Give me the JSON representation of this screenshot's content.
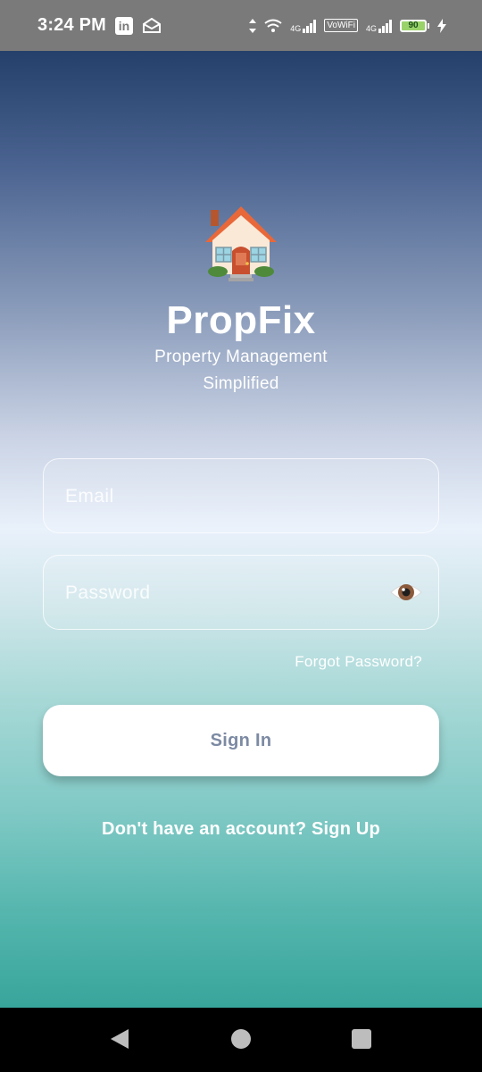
{
  "status_bar": {
    "time": "3:24 PM",
    "linkedin_icon": "linkedin-icon",
    "mail_icon": "mail-open-icon",
    "network_label_1": "4G",
    "vowifi_label": "VoWiFi",
    "network_label_2": "4G",
    "battery_level": "90"
  },
  "app": {
    "logo_icon": "house-icon",
    "title": "PropFix",
    "subtitle": "Property Management Simplified",
    "email_placeholder": "Email",
    "password_placeholder": "Password",
    "forgot_password": "Forgot Password?",
    "sign_in_label": "Sign In",
    "sign_up_prompt": "Don't have an account? Sign Up"
  },
  "colors": {
    "gradient_top": "#25406b",
    "gradient_middle": "#e9f1fb",
    "gradient_bottom": "#38a59b",
    "button_text": "#7c8aa3"
  }
}
